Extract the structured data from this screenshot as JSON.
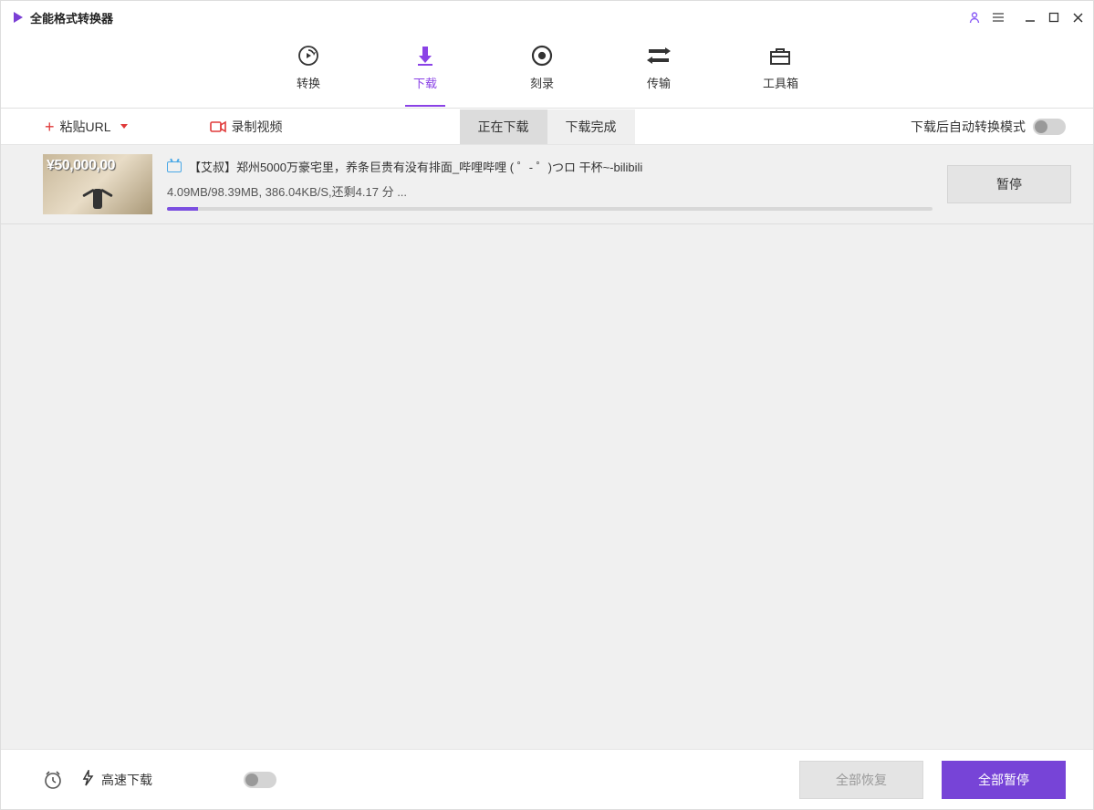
{
  "app": {
    "title": "全能格式转换器"
  },
  "nav": {
    "convert": "转换",
    "download": "下载",
    "burn": "刻录",
    "transfer": "传输",
    "toolbox": "工具箱"
  },
  "toolbar": {
    "paste_url": "粘贴URL",
    "record": "录制视频",
    "tab_downloading": "正在下载",
    "tab_completed": "下载完成",
    "auto_convert_label": "下载后自动转换模式"
  },
  "items": [
    {
      "title": "【艾叔】郑州5000万豪宅里，养条巨贵有没有排面_哔哩哔哩 ( ゜- ゜)つロ 干杯~-bilibili",
      "status": "4.09MB/98.39MB, 386.04KB/S,还剩4.17 分 ...",
      "progress_percent": 4,
      "pause_label": "暂停",
      "thumb_text": "¥50,000,00"
    }
  ],
  "footer": {
    "speed_label": "高速下载",
    "resume_all": "全部恢复",
    "pause_all": "全部暂停"
  }
}
